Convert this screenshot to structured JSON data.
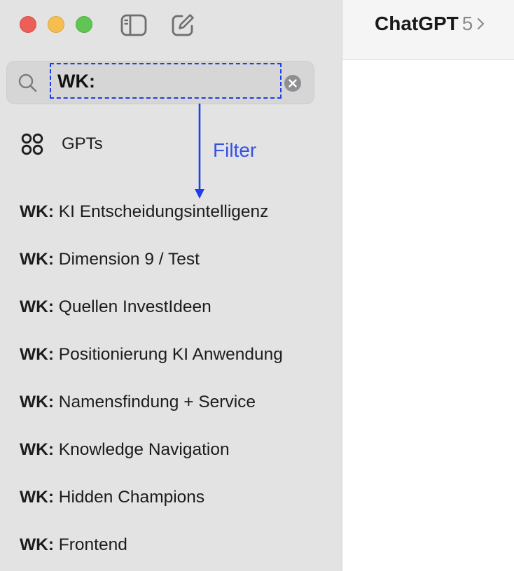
{
  "window": {
    "controls": [
      "close",
      "minimize",
      "maximize"
    ],
    "toolbar_icons": [
      "sidebar-toggle-icon",
      "compose-icon"
    ]
  },
  "search": {
    "value": "WK:",
    "icon": "search-icon",
    "clear_icon": "clear-icon"
  },
  "annotation": {
    "label": "Filter",
    "color": "#3552e3"
  },
  "sidebar": {
    "gpts_label": "GPTs",
    "gpts_icon": "grid-icon",
    "chats": [
      {
        "prefix": "WK:",
        "title": "KI Entscheidungsintelligenz"
      },
      {
        "prefix": "WK:",
        "title": "Dimension 9 / Test"
      },
      {
        "prefix": "WK:",
        "title": "Quellen InvestIdeen"
      },
      {
        "prefix": "WK:",
        "title": "Positionierung KI Anwendung"
      },
      {
        "prefix": "WK:",
        "title": "Namensfindung + Service"
      },
      {
        "prefix": "WK:",
        "title": "Knowledge Navigation"
      },
      {
        "prefix": "WK:",
        "title": "Hidden Champions"
      },
      {
        "prefix": "WK:",
        "title": "Frontend"
      }
    ]
  },
  "header": {
    "model_name": "ChatGPT",
    "model_version": "5",
    "chevron_icon": "chevron-right-icon"
  },
  "colors": {
    "sidebar_bg": "#e3e3e3",
    "accent_blue": "#1f3ee8",
    "traffic_close": "#ec5f58",
    "traffic_minimize": "#f4bf4f",
    "traffic_maximize": "#61c554"
  }
}
